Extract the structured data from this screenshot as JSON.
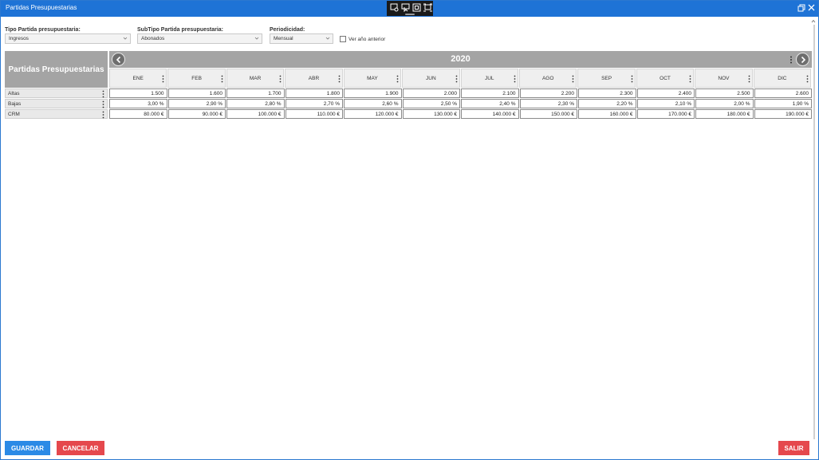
{
  "window": {
    "title": "Partidas Presupuestarias"
  },
  "filters": {
    "tipo": {
      "label": "Tipo Partida presupuestaria:",
      "value": "Ingresos"
    },
    "subtipo": {
      "label": "SubTipo Partida presupuestaria:",
      "value": "Abonados"
    },
    "periodicidad": {
      "label": "Periodicidad:",
      "value": "Mensual"
    },
    "ver_anterior": {
      "label": "Ver año anterior",
      "checked": false
    }
  },
  "grid": {
    "corner_title": "Partidas Presupuestarias",
    "year": "2020",
    "months": [
      "ENE",
      "FEB",
      "MAR",
      "ABR",
      "MAY",
      "JUN",
      "JUL",
      "AGO",
      "SEP",
      "OCT",
      "NOV",
      "DIC"
    ],
    "rows": [
      {
        "label": "Altas",
        "values": [
          "1.500",
          "1.600",
          "1.700",
          "1.800",
          "1.900",
          "2.000",
          "2.100",
          "2.200",
          "2.300",
          "2.400",
          "2.500",
          "2.600"
        ]
      },
      {
        "label": "Bajas",
        "values": [
          "3,00 %",
          "2,90 %",
          "2,80 %",
          "2,70 %",
          "2,60 %",
          "2,50 %",
          "2,40 %",
          "2,30 %",
          "2,20 %",
          "2,10 %",
          "2,00 %",
          "1,90 %"
        ]
      },
      {
        "label": "CRM",
        "values": [
          "80.000 €",
          "90.000 €",
          "100.000 €",
          "110.000 €",
          "120.000 €",
          "130.000 €",
          "140.000 €",
          "150.000 €",
          "160.000 €",
          "170.000 €",
          "180.000 €",
          "190.000 €"
        ]
      }
    ]
  },
  "buttons": {
    "save": "GUARDAR",
    "cancel": "CANCELAR",
    "exit": "SALIR"
  },
  "colors": {
    "titlebar": "#1e73d6",
    "header_gray": "#a4a4a4",
    "save": "#2b8ae6",
    "danger": "#e5484d"
  }
}
